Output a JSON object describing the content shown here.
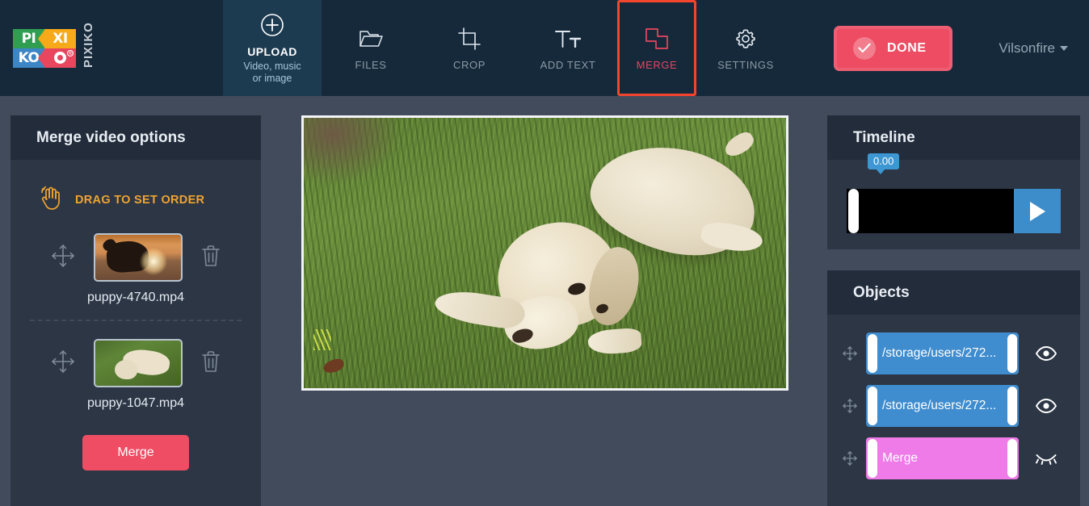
{
  "brand": {
    "logo_cells": [
      "PI",
      "XI",
      "KO",
      "O"
    ],
    "logo_wordmark": "PIXIKO",
    "registered_mark": "®"
  },
  "header": {
    "upload": {
      "label": "UPLOAD",
      "sub_line1": "Video, music",
      "sub_line2": "or image",
      "icon": "plus-circle-icon"
    },
    "nav_items": [
      {
        "label": "FILES",
        "icon": "folder-icon",
        "active": false
      },
      {
        "label": "CROP",
        "icon": "crop-icon",
        "active": false
      },
      {
        "label": "ADD TEXT",
        "icon": "text-size-icon",
        "active": false
      },
      {
        "label": "MERGE",
        "icon": "merge-squares-icon",
        "active": true
      },
      {
        "label": "SETTINGS",
        "icon": "gear-icon",
        "active": false
      }
    ],
    "done_button": {
      "label": "DONE",
      "icon": "check-circle-icon"
    },
    "user_menu": {
      "name": "Vilsonfire",
      "icon": "chevron-down-icon"
    }
  },
  "left_panel": {
    "title": "Merge video options",
    "drag_hint": {
      "text": "DRAG TO SET ORDER",
      "icon": "hand-drag-icon"
    },
    "videos": [
      {
        "name": "puppy-4740.mp4",
        "move_icon": "move-arrows-icon",
        "delete_icon": "trash-icon",
        "thumb": "dog-on-beach-sunset"
      },
      {
        "name": "puppy-1047.mp4",
        "move_icon": "move-arrows-icon",
        "delete_icon": "trash-icon",
        "thumb": "puppy-on-grass"
      }
    ],
    "merge_button": "Merge"
  },
  "canvas": {
    "preview": "golden-retriever-puppy-lying-on-grass"
  },
  "timeline": {
    "title": "Timeline",
    "time_badge": "0.00",
    "play_icon": "play-icon"
  },
  "objects": {
    "title": "Objects",
    "rows": [
      {
        "label": "/storage/users/272...",
        "color": "#3f8cce",
        "visible": true,
        "eye_icon": "eye-open-icon",
        "move_icon": "move-arrows-icon"
      },
      {
        "label": "/storage/users/272...",
        "color": "#3f8cce",
        "visible": true,
        "eye_icon": "eye-open-icon",
        "move_icon": "move-arrows-icon"
      },
      {
        "label": "Merge",
        "color": "#ee7be8",
        "visible": false,
        "eye_icon": "eye-closed-icon",
        "move_icon": "move-arrows-icon"
      }
    ]
  },
  "colors": {
    "header_bg": "#15293a",
    "upload_tab_bg": "#1c3a50",
    "page_bg": "#424b5c",
    "panel_bg": "#2c3645",
    "panel_head_bg": "#222c3a",
    "accent_red": "#ee4c62",
    "highlight_border": "#f4452f",
    "accent_orange": "#f0a431",
    "accent_blue": "#3d8dcb",
    "accent_pink": "#ee7be8"
  }
}
